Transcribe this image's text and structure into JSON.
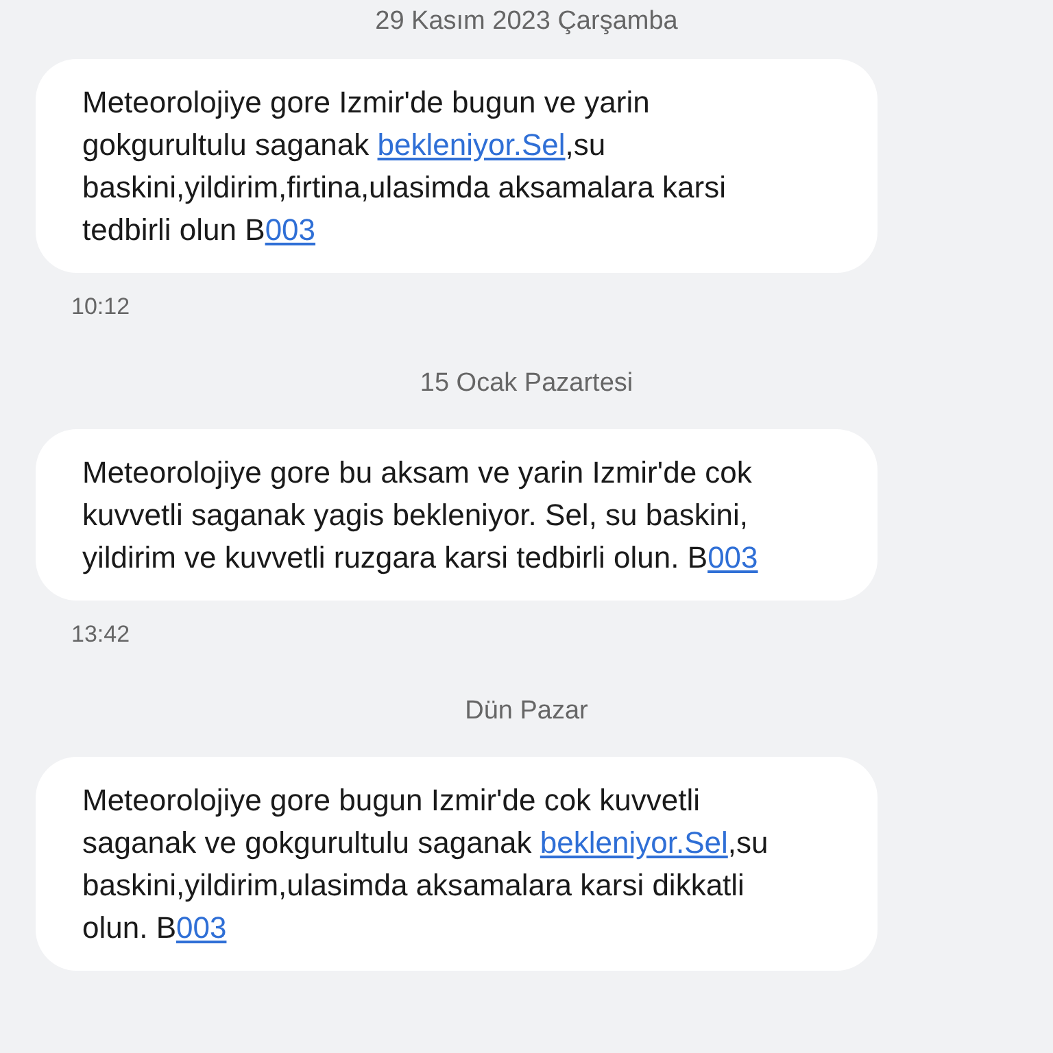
{
  "threads": [
    {
      "date": "29 Kasım 2023 Çarşamba",
      "segments": [
        {
          "kind": "text",
          "text": "Meteorolojiye gore Izmir'de bugun ve yarin gokgurultulu saganak "
        },
        {
          "kind": "link",
          "text": "bekleniyor.Sel"
        },
        {
          "kind": "text",
          "text": ",su baskini,yildirim,firtina,ulasimda aksamalara karsi tedbirli olun B"
        },
        {
          "kind": "link",
          "text": "003"
        }
      ],
      "time": "10:12"
    },
    {
      "date": "15 Ocak Pazartesi",
      "segments": [
        {
          "kind": "text",
          "text": "Meteorolojiye gore bu aksam ve yarin Izmir'de cok kuvvetli saganak yagis bekleniyor. Sel, su baskini, yildirim ve kuvvetli ruzgara karsi tedbirli olun. B"
        },
        {
          "kind": "link",
          "text": "003"
        }
      ],
      "time": "13:42"
    },
    {
      "date": "Dün Pazar",
      "segments": [
        {
          "kind": "text",
          "text": "Meteorolojiye gore bugun Izmir'de cok kuvvetli saganak ve gokgurultulu saganak "
        },
        {
          "kind": "link",
          "text": "bekleniyor.Sel"
        },
        {
          "kind": "text",
          "text": ",su baskini,yildirim,ulasimda aksamalara karsi dikkatli olun. B"
        },
        {
          "kind": "link",
          "text": "003"
        }
      ]
    }
  ]
}
